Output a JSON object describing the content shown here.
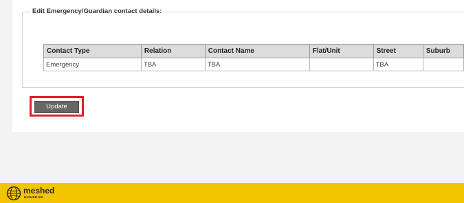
{
  "section": {
    "legend": "Edit Emergency/Guardian contact details:"
  },
  "table": {
    "headers": [
      "Contact Type",
      "Relation",
      "Contact Name",
      "Flat/Unit",
      "Street",
      "Suburb"
    ],
    "rows": [
      [
        "Emergency",
        "TBA",
        "TBA",
        "",
        "TBA",
        ""
      ]
    ]
  },
  "actions": {
    "update_label": "Update"
  },
  "footer": {
    "logo_text": "meshed",
    "logo_subtext": "HIGHER-ED",
    "background_color": "#f2c500"
  },
  "colors": {
    "highlight_border": "#e0202a",
    "button_background": "#666666"
  }
}
